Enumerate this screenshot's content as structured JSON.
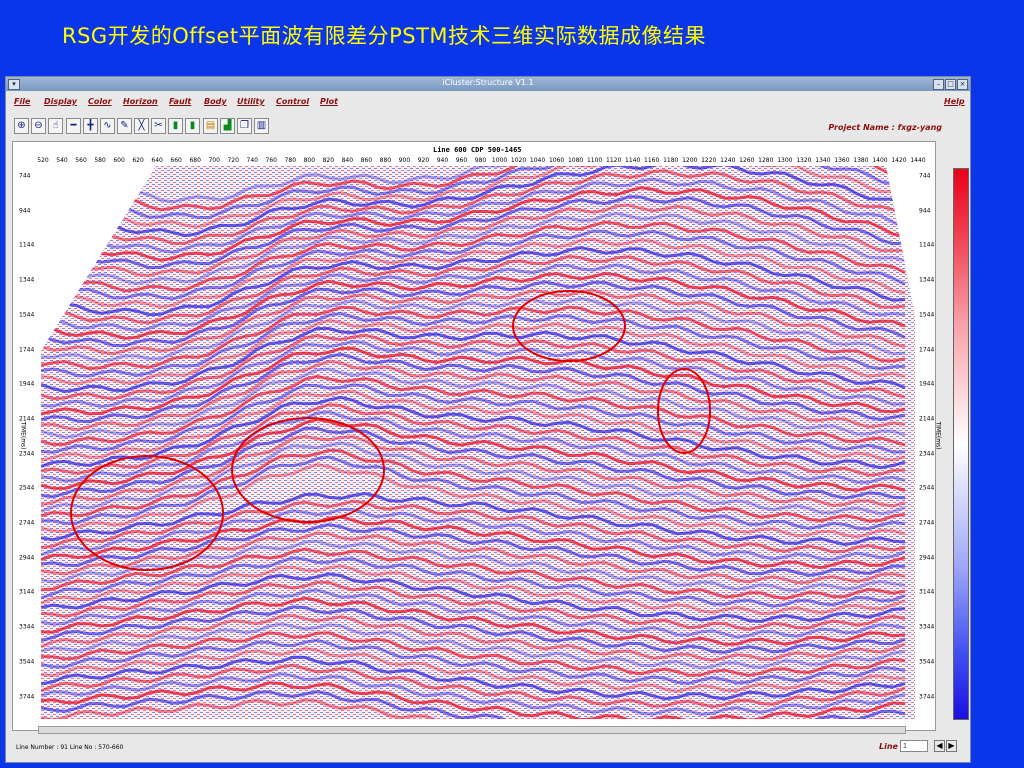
{
  "slide_title": "RSG开发的Offset平面波有限差分PSTM技术三维实际数据成像结果",
  "window": {
    "title": "iCluster:Structure V1.1",
    "buttons": {
      "minimize": "–",
      "maximize": "□",
      "close": "×"
    }
  },
  "menu": {
    "items": [
      "File",
      "Display",
      "Color",
      "Horizon",
      "Fault",
      "Body",
      "Utility",
      "Control",
      "Plot"
    ],
    "help": "Help"
  },
  "toolbar": {
    "icons": [
      "zoom-in-icon",
      "zoom-out-icon",
      "pan-icon",
      "horizontal-line-icon",
      "cross-line-icon",
      "wave-icon",
      "pencil-icon",
      "fault-pick-icon",
      "cut-icon",
      "horizon-pick-icon",
      "horizon-pick-alt-icon",
      "layer-icon",
      "amplitude-icon",
      "copy-icon",
      "page-icon"
    ],
    "project_name": "Project Name : fxgz-yang"
  },
  "plot": {
    "title": "Line 600    CDP 500-1465",
    "x_ticks": [
      "520",
      "540",
      "560",
      "580",
      "600",
      "620",
      "640",
      "660",
      "680",
      "700",
      "720",
      "740",
      "760",
      "780",
      "800",
      "820",
      "840",
      "860",
      "880",
      "900",
      "920",
      "940",
      "960",
      "980",
      "1000",
      "1020",
      "1040",
      "1060",
      "1080",
      "1100",
      "1120",
      "1140",
      "1160",
      "1180",
      "1200",
      "1220",
      "1240",
      "1260",
      "1280",
      "1300",
      "1320",
      "1340",
      "1360",
      "1380",
      "1400",
      "1420",
      "1440"
    ],
    "y_ticks": [
      "744",
      "944",
      "1144",
      "1344",
      "1544",
      "1744",
      "1944",
      "2144",
      "2344",
      "2544",
      "2744",
      "2944",
      "3144",
      "3344",
      "3544",
      "3744"
    ],
    "y_label": "TIME(ms)"
  },
  "colors": {
    "background": "#0a35e8",
    "title_text": "#ffff00",
    "positive_amplitude": "#e8001a",
    "negative_amplitude": "#1a10e0",
    "annotation_circle": "#e00000"
  },
  "status": {
    "text": "Line Number : 91   Line No : 570-660",
    "line_label": "Line",
    "line_value": "1"
  }
}
